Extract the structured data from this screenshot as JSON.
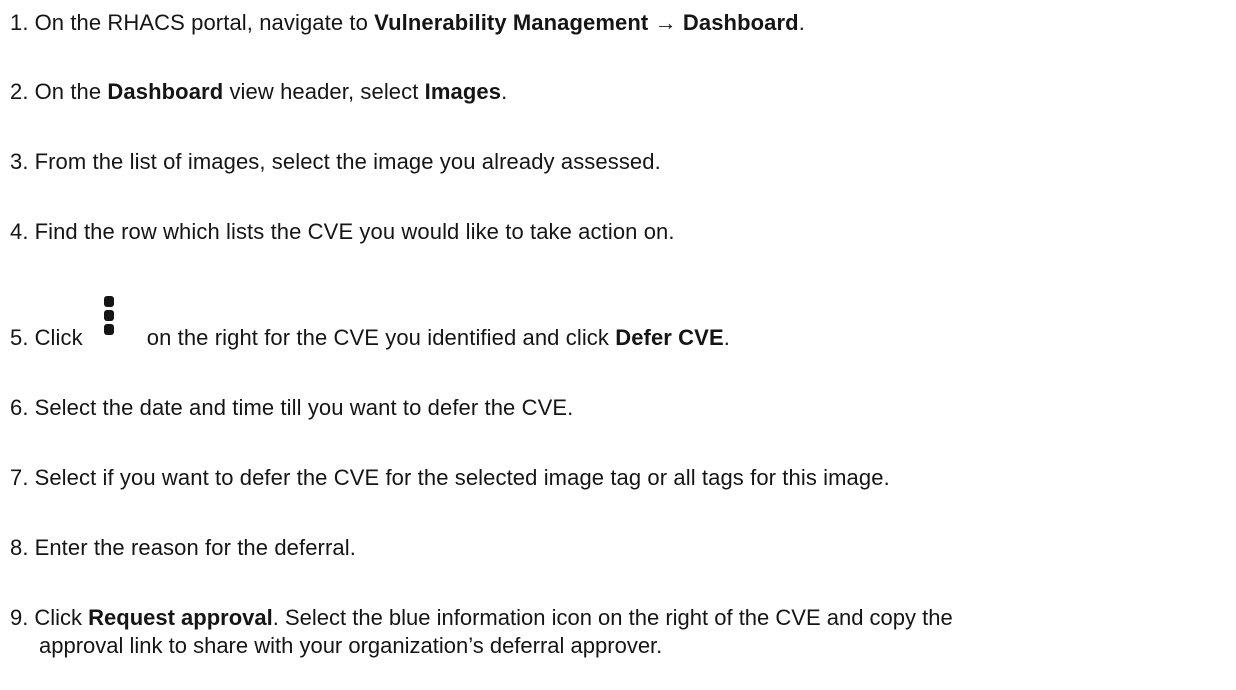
{
  "steps": [
    {
      "number": "1.",
      "parts": [
        {
          "text": "On the RHACS portal, navigate to ",
          "bold": false
        },
        {
          "text": "Vulnerability Management → Dashboard",
          "bold": true
        },
        {
          "text": ".",
          "bold": false
        }
      ]
    },
    {
      "number": "2.",
      "parts": [
        {
          "text": "On the ",
          "bold": false
        },
        {
          "text": "Dashboard",
          "bold": true
        },
        {
          "text": " view header, select ",
          "bold": false
        },
        {
          "text": "Images",
          "bold": true
        },
        {
          "text": ".",
          "bold": false
        }
      ]
    },
    {
      "number": "3.",
      "parts": [
        {
          "text": "From the list of images, select the image you already assessed.",
          "bold": false
        }
      ]
    },
    {
      "number": "4.",
      "parts": [
        {
          "text": "Find the row which lists the CVE you would like to take action on.",
          "bold": false
        }
      ]
    },
    {
      "number": "5.",
      "parts_before_icon": [
        {
          "text": "Click",
          "bold": false
        }
      ],
      "icon": "kebab-menu-icon",
      "parts_after_icon": [
        {
          "text": "on the right for the CVE you identified and click ",
          "bold": false
        },
        {
          "text": "Defer CVE",
          "bold": true
        },
        {
          "text": ".",
          "bold": false
        }
      ]
    },
    {
      "number": "6.",
      "parts": [
        {
          "text": "Select the date and time till you want to defer the CVE.",
          "bold": false
        }
      ]
    },
    {
      "number": "7.",
      "parts": [
        {
          "text": "Select if you want to defer the CVE for the selected image tag or all tags for this image.",
          "bold": false
        }
      ]
    },
    {
      "number": "8.",
      "parts": [
        {
          "text": "Enter the reason for the deferral.",
          "bold": false
        }
      ]
    },
    {
      "number": "9.",
      "parts": [
        {
          "text": "Click ",
          "bold": false
        },
        {
          "text": "Request approval",
          "bold": true
        },
        {
          "text": ". Select the blue information icon on the right of the CVE and copy the",
          "bold": false
        }
      ],
      "continuation": "approval link to share with your organization’s deferral approver."
    }
  ],
  "colors": {
    "text": "#151515",
    "background": "#ffffff"
  }
}
